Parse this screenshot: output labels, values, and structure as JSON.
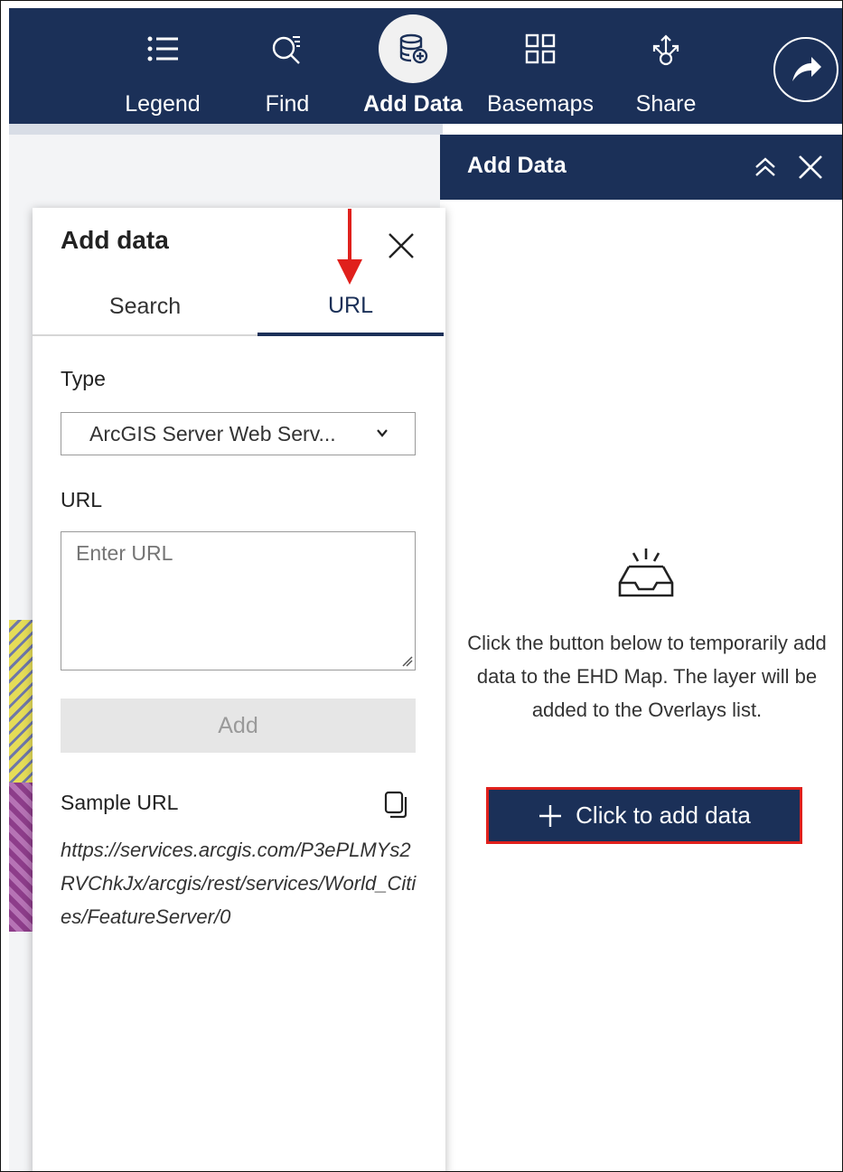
{
  "toolbar": {
    "items": [
      {
        "label": "Legend",
        "icon": "list-icon"
      },
      {
        "label": "Find",
        "icon": "find-icon"
      },
      {
        "label": "Add Data",
        "icon": "add-data-icon",
        "active": true
      },
      {
        "label": "Basemaps",
        "icon": "basemaps-icon"
      },
      {
        "label": "Share",
        "icon": "share-icon"
      }
    ],
    "share_circle_icon": "share-arrow-icon"
  },
  "right_panel": {
    "title": "Add Data",
    "collapse_icon": "chevrons-up-icon",
    "close_icon": "close-icon",
    "empty_icon": "inbox-icon",
    "empty_text": "Click the button below to temporarily add data to the EHD Map. The layer will be added to the Overlays list.",
    "add_button_label": "Click to add data"
  },
  "modal": {
    "title": "Add data",
    "tabs": [
      {
        "label": "Search",
        "selected": false
      },
      {
        "label": "URL",
        "selected": true
      }
    ],
    "type_label": "Type",
    "type_value": "ArcGIS Server Web Serv...",
    "url_label": "URL",
    "url_placeholder": "Enter URL",
    "add_label": "Add",
    "sample_label": "Sample URL",
    "sample_url": "https://services.arcgis.com/P3ePLMYs2RVChkJx/arcgis/rest/services/World_Cities/FeatureServer/0"
  },
  "colors": {
    "navy": "#1b3058",
    "highlight_red": "#e0201c"
  }
}
